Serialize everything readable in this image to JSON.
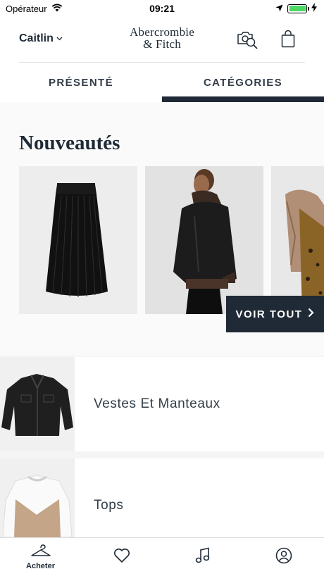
{
  "status_bar": {
    "carrier": "Opérateur",
    "time": "09:21"
  },
  "header": {
    "user_name": "Caitlin",
    "logo_line1": "Abercrombie",
    "logo_line2": "& Fitch"
  },
  "tabs": [
    {
      "label": "PRÉSENTÉ",
      "active": false
    },
    {
      "label": "CATÉGORIES",
      "active": true
    }
  ],
  "new_arrivals": {
    "title": "Nouveautés",
    "see_all_label": "VOIR TOUT",
    "items": [
      {
        "icon": "pleated-skirt"
      },
      {
        "icon": "leather-jacket"
      },
      {
        "icon": "shearling-coat"
      }
    ]
  },
  "categories": [
    {
      "label": "Vestes Et Manteaux",
      "icon": "denim-jacket"
    },
    {
      "label": "Tops",
      "icon": "colorblock-sweater"
    }
  ],
  "bottom_nav": [
    {
      "label": "Acheter",
      "icon": "hanger-icon"
    },
    {
      "label": "",
      "icon": "heart-icon"
    },
    {
      "label": "",
      "icon": "music-icon"
    },
    {
      "label": "",
      "icon": "account-icon"
    }
  ],
  "colors": {
    "navy": "#1f2a36",
    "battery": "#4cd964"
  }
}
